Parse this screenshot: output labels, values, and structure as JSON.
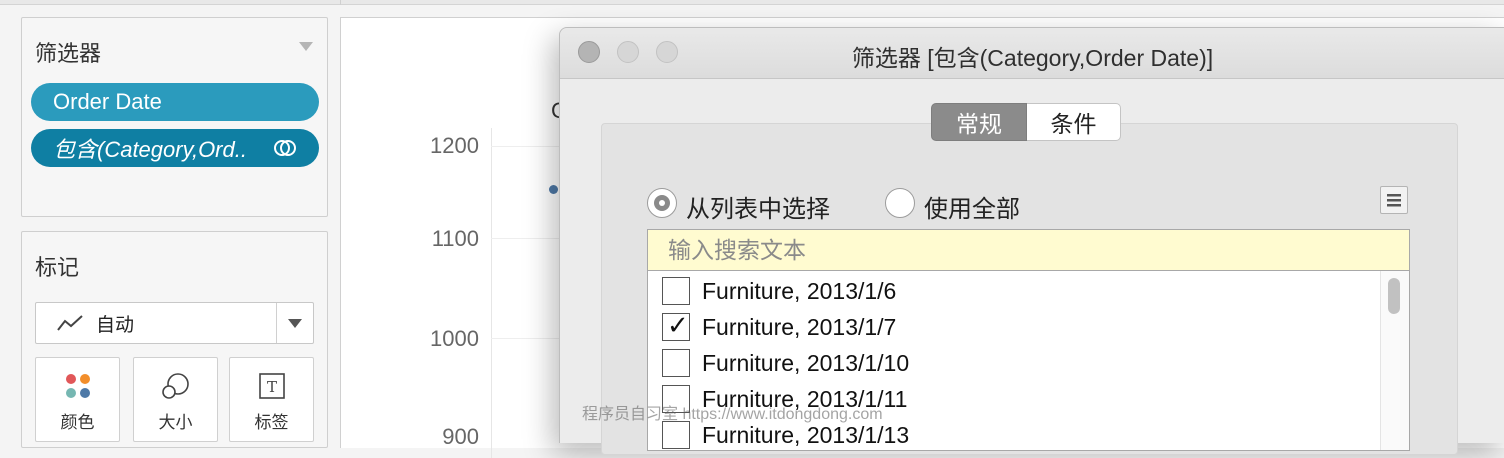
{
  "filters_shelf": {
    "title": "筛选器",
    "pills": [
      {
        "label": "Order Date",
        "color": "#2b9bbd"
      },
      {
        "label": "包含(Category,Ord..",
        "color": "#0f7fa3"
      }
    ]
  },
  "marks_card": {
    "title": "标记",
    "mark_type": "自动",
    "buttons": [
      {
        "label": "颜色",
        "icon": "color-dots-icon"
      },
      {
        "label": "大小",
        "icon": "size-circles-icon"
      },
      {
        "label": "标签",
        "icon": "text-label-icon"
      }
    ]
  },
  "chart": {
    "header_fragment": "C",
    "y_ticks": [
      "1200",
      "1100",
      "1000",
      "900"
    ]
  },
  "dialog": {
    "title": "筛选器 [包含(Category,Order Date)]",
    "tabs": {
      "general": "常规",
      "condition": "条件",
      "active": "general"
    },
    "radio_select_from_list": "从列表中选择",
    "radio_use_all": "使用全部",
    "search_placeholder": "输入搜索文本",
    "items": [
      {
        "label": "Furniture, 2013/1/6",
        "checked": false
      },
      {
        "label": "Furniture, 2013/1/7",
        "checked": true
      },
      {
        "label": "Furniture, 2013/1/10",
        "checked": false
      },
      {
        "label": "Furniture, 2013/1/11",
        "checked": false
      },
      {
        "label": "Furniture, 2013/1/13",
        "checked": false
      }
    ]
  },
  "watermark": "程序员自习室 https://www.itdongdong.com",
  "colors": {
    "accent": "#2b9bbd",
    "accent_dark": "#0f7fa3",
    "active_tab": "#8b8b8b",
    "search_bg": "#fffbd0"
  }
}
